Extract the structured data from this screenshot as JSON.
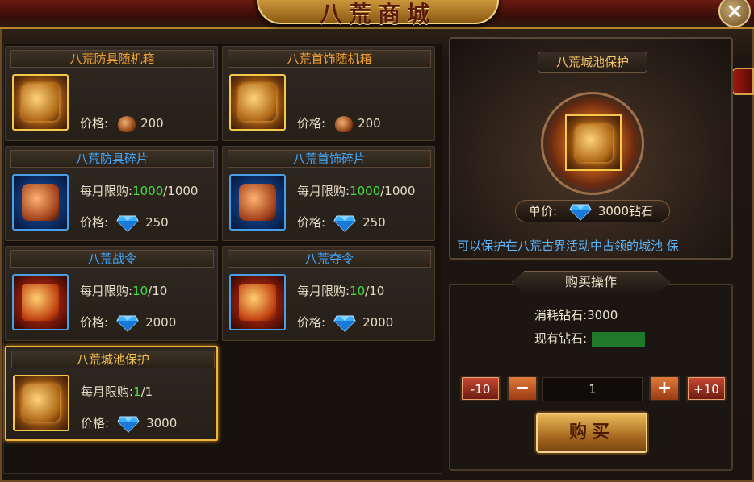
{
  "window": {
    "title": "八荒商城",
    "close_label": "×"
  },
  "items": [
    {
      "name": "八荒防具随机箱",
      "title_color": "orange",
      "thumb": "gold",
      "price_label": "价格:",
      "currency_icon": "coin-icon",
      "price": "200"
    },
    {
      "name": "八荒首饰随机箱",
      "title_color": "orange",
      "thumb": "gold",
      "price_label": "价格:",
      "currency_icon": "coin-icon",
      "price": "200"
    },
    {
      "name": "八荒防具碎片",
      "title_color": "blue",
      "thumb": "blue",
      "limit_label": "每月限购:",
      "limit_used": "1000",
      "limit_total": "/1000",
      "price_label": "价格:",
      "currency_icon": "diamond-icon",
      "price": "250"
    },
    {
      "name": "八荒首饰碎片",
      "title_color": "blue",
      "thumb": "blue",
      "limit_label": "每月限购:",
      "limit_used": "1000",
      "limit_total": "/1000",
      "price_label": "价格:",
      "currency_icon": "diamond-icon",
      "price": "250"
    },
    {
      "name": "八荒战令",
      "title_color": "blue",
      "thumb": "red",
      "limit_label": "每月限购:",
      "limit_used": "10",
      "limit_total": "/10",
      "price_label": "价格:",
      "currency_icon": "diamond-icon",
      "price": "2000"
    },
    {
      "name": "八荒夺令",
      "title_color": "blue",
      "thumb": "red",
      "limit_label": "每月限购:",
      "limit_used": "10",
      "limit_total": "/10",
      "price_label": "价格:",
      "currency_icon": "diamond-icon",
      "price": "2000"
    },
    {
      "name": "八荒城池保护",
      "title_color": "gold",
      "thumb": "gold",
      "limit_label": "每月限购:",
      "limit_used": "1",
      "limit_total": "/1",
      "price_label": "价格:",
      "currency_icon": "diamond-icon",
      "price": "3000",
      "selected": true
    }
  ],
  "detail": {
    "title": "八荒城池保护",
    "unit_price_label": "单价:",
    "unit_price": "3000钻石",
    "description": "可以保护在八荒古界活动中占领的城池 保"
  },
  "purchase": {
    "title": "购买操作",
    "cost_label": "消耗钻石:",
    "cost_value": "3000",
    "owned_label": "现有钻石:",
    "minus10": "-10",
    "minus": "−",
    "quantity": "1",
    "plus": "+",
    "plus10": "+10",
    "buy_label": "购买"
  },
  "colors": {
    "accent_gold": "#f0b43a",
    "limit_green": "#3fe23f",
    "title_blue": "#3fa8ff",
    "title_orange": "#f0a030",
    "marquee_blue": "#5ab8ff"
  }
}
